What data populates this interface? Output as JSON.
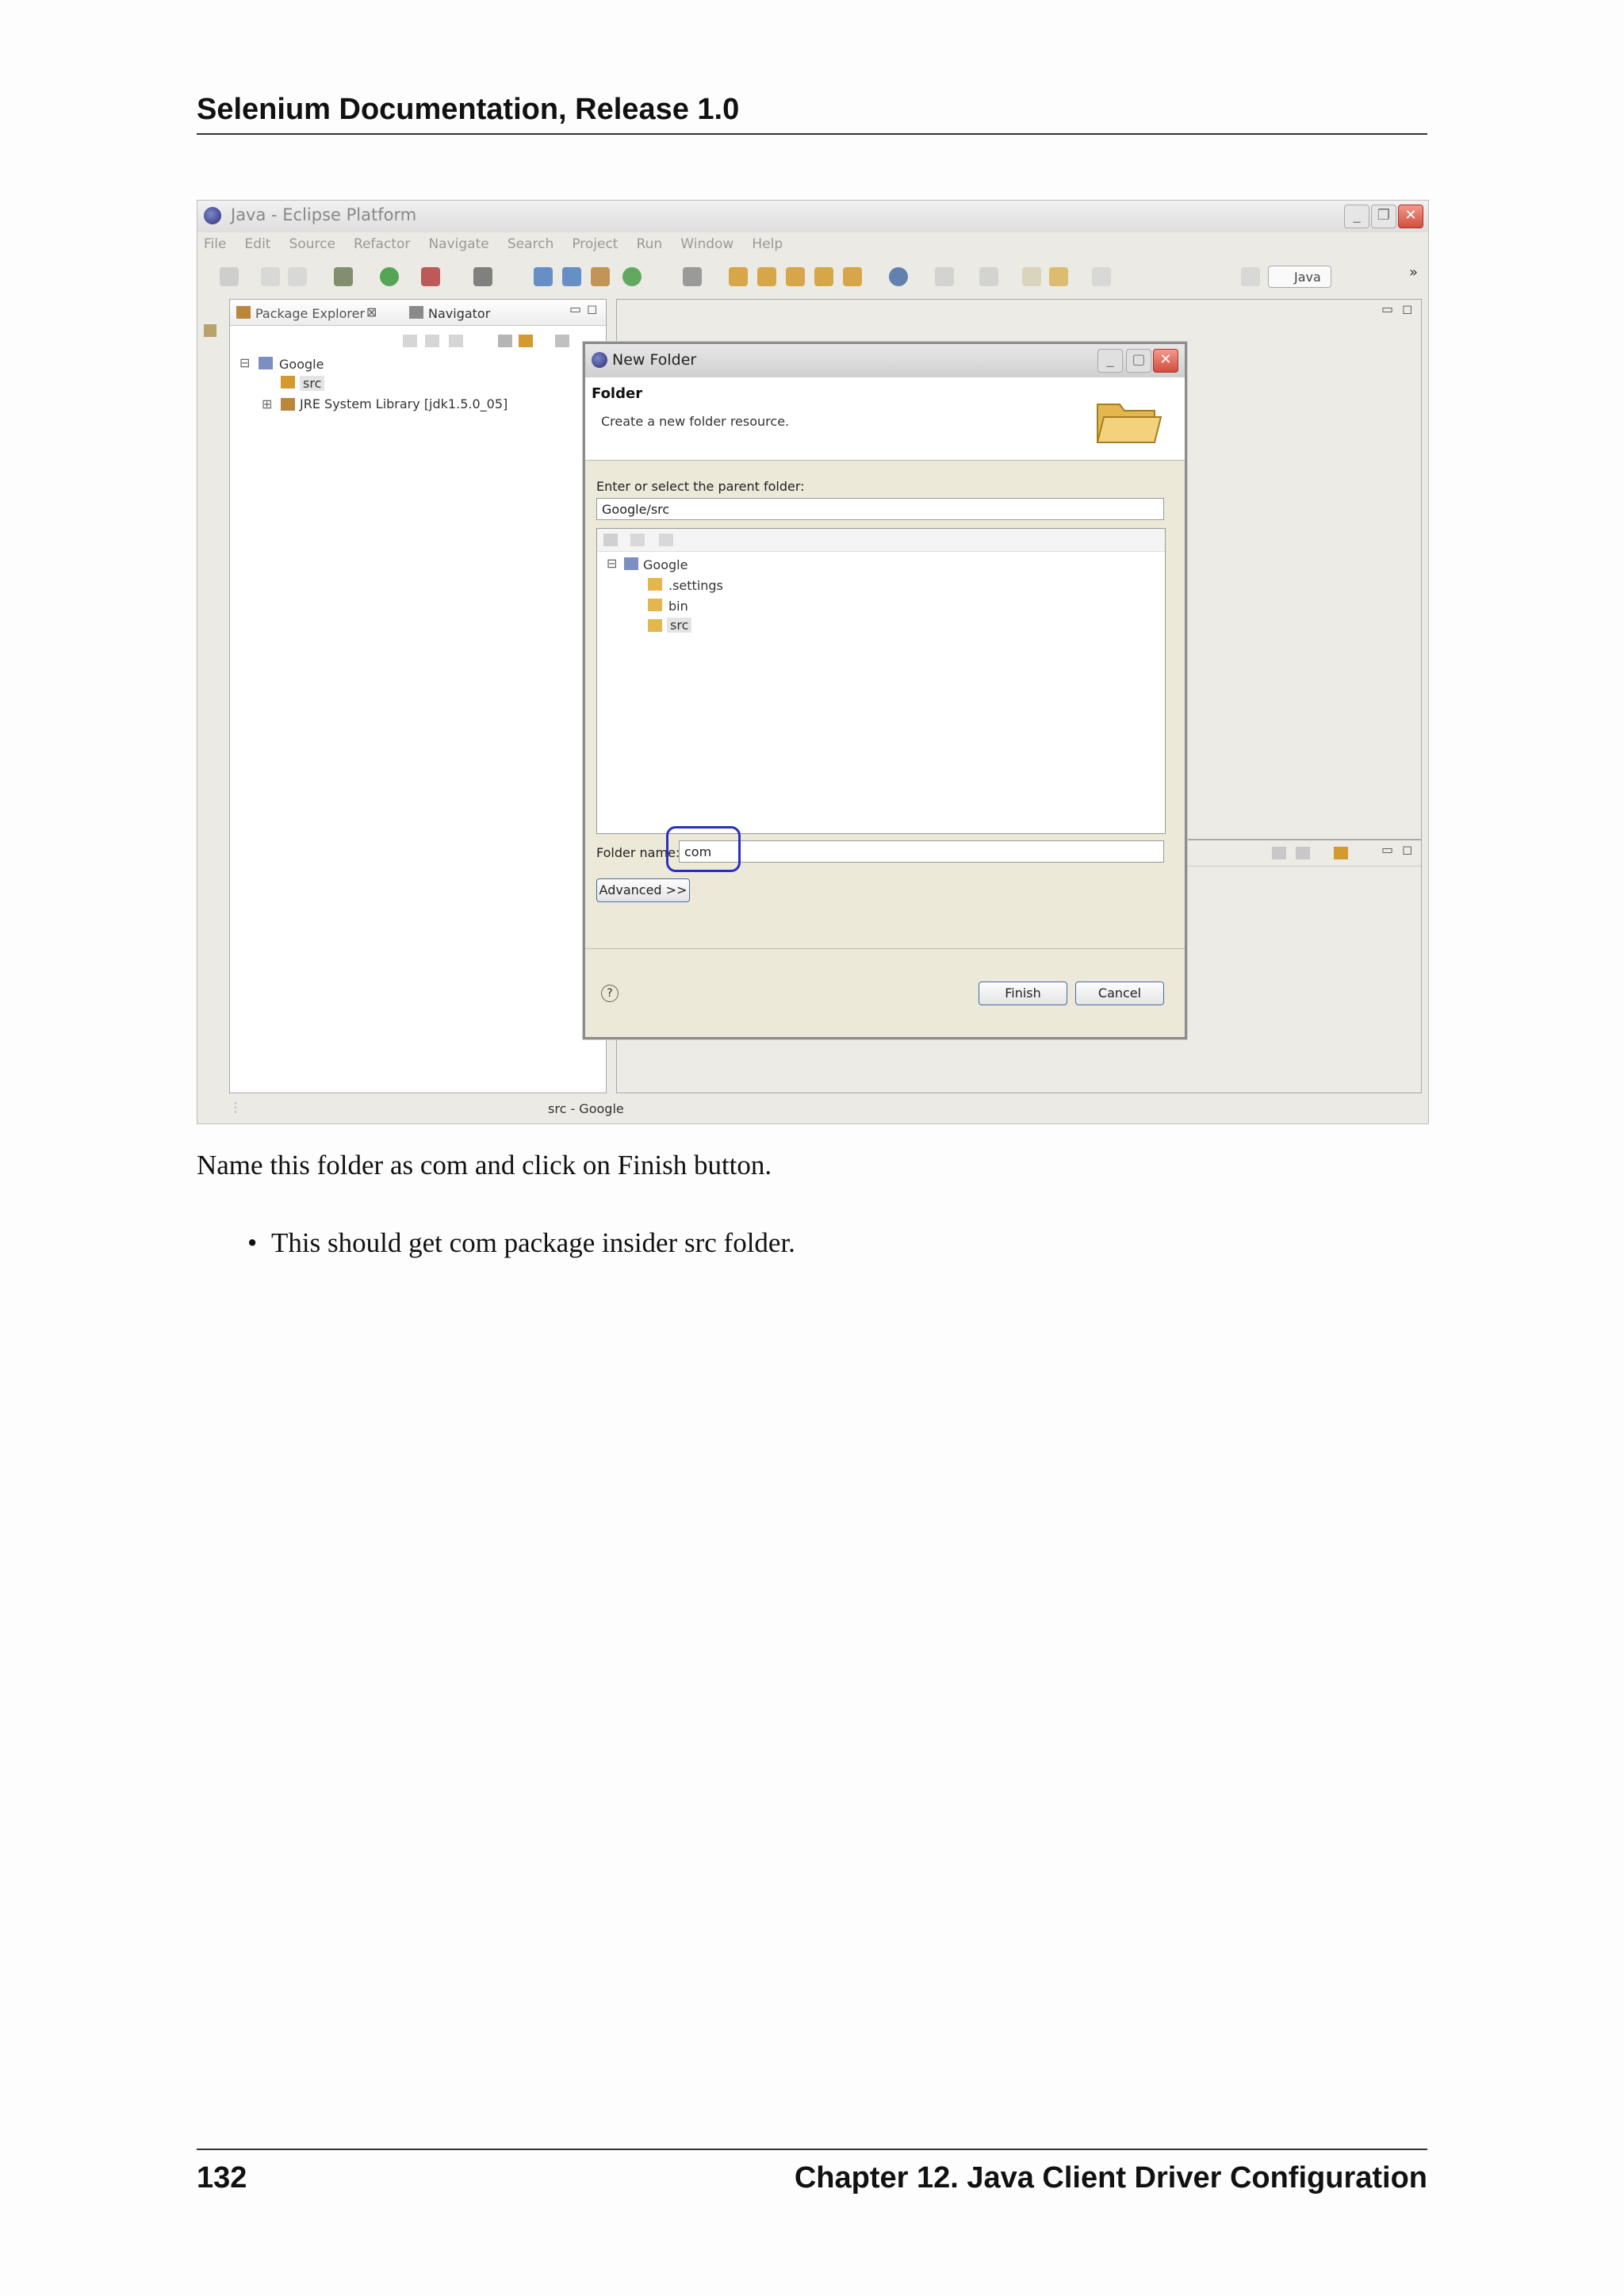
{
  "page": {
    "header_title": "Selenium Documentation, Release 1.0",
    "page_number": "132",
    "chapter": "Chapter 12.  Java Client Driver Configuration",
    "paragraph": "Name this folder as com and click on Finish button.",
    "bullet": "This should get com package insider src folder."
  },
  "eclipse": {
    "window_title": "Java - Eclipse Platform",
    "menus": [
      "File",
      "Edit",
      "Source",
      "Refactor",
      "Navigate",
      "Search",
      "Project",
      "Run",
      "Window",
      "Help"
    ],
    "perspective": "Java",
    "tabs": {
      "package_explorer": "Package Explorer",
      "navigator": "Navigator"
    },
    "tree": {
      "project": "Google",
      "src": "src",
      "jre": "JRE System Library [jdk1.5.0_05]"
    },
    "status": "src - Google"
  },
  "dialog": {
    "title": "New Folder",
    "heading": "Folder",
    "description": "Create a new folder resource.",
    "parent_label": "Enter or select the parent folder:",
    "parent_value": "Google/src",
    "tree": {
      "root": "Google",
      "items": [
        ".settings",
        "bin",
        "src"
      ]
    },
    "folder_label": "Folder name:",
    "folder_value": "com",
    "advanced": "Advanced >>",
    "finish": "Finish",
    "cancel": "Cancel",
    "help": "?"
  },
  "colors": {
    "highlight_ring": "#2a2fbf",
    "close_button": "#d24d3c"
  }
}
